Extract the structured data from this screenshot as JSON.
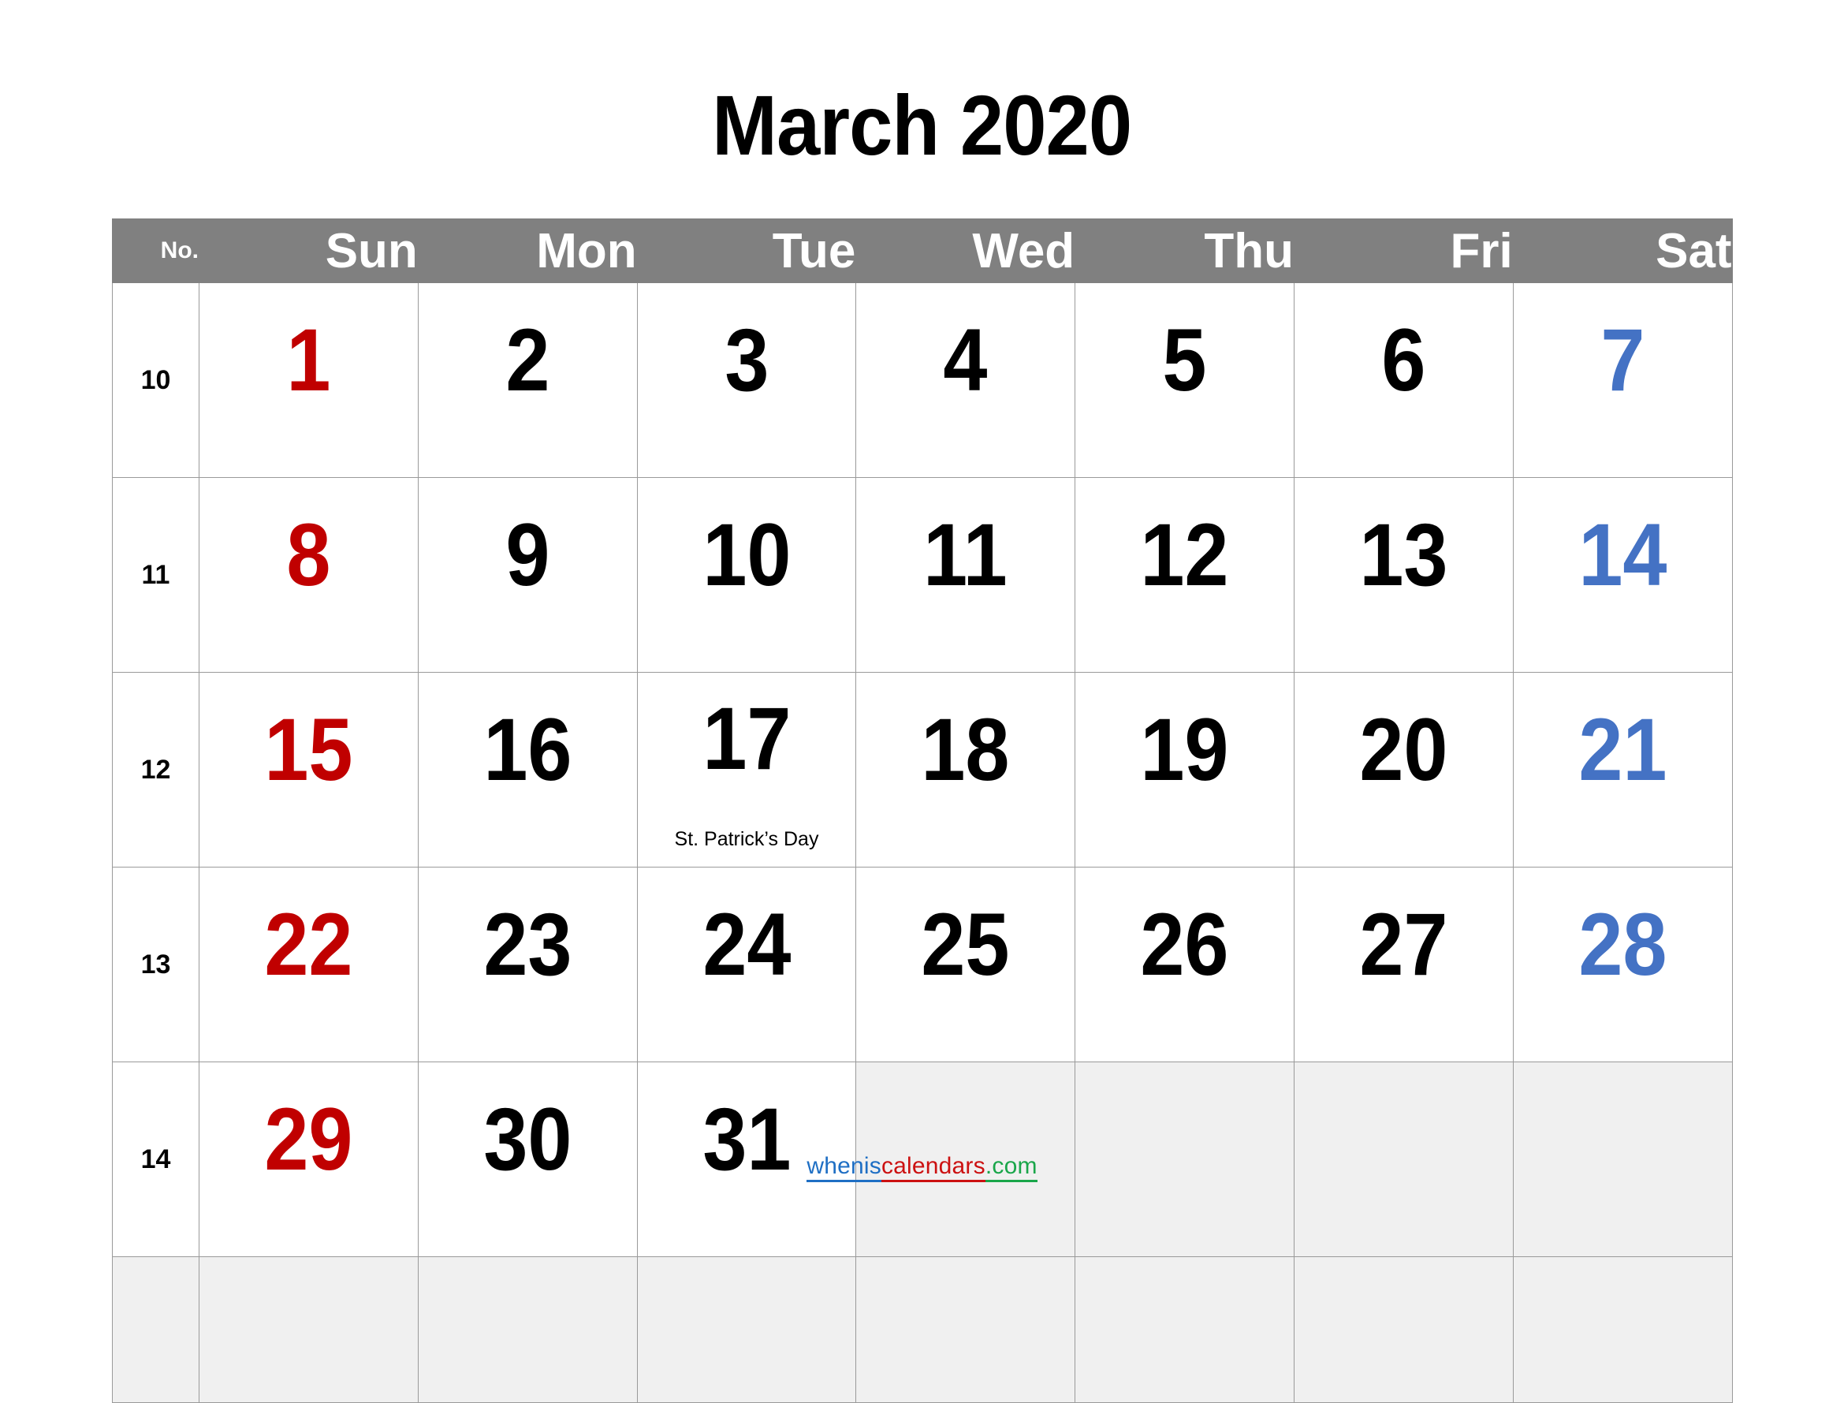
{
  "title": "March 2020",
  "header": {
    "week_number_label": "No.",
    "weekdays": [
      "Sun",
      "Mon",
      "Tue",
      "Wed",
      "Thu",
      "Fri",
      "Sat"
    ]
  },
  "colors": {
    "header_background": "#808080",
    "header_text": "#ffffff",
    "sunday": "#c00000",
    "saturday": "#4472c4",
    "weekday": "#000000",
    "empty_cell": "#f0f0f0",
    "grid_line": "#9a9a9a",
    "brand_blue": "#1f6fc4",
    "brand_red": "#cc1111",
    "brand_green": "#1aa64a"
  },
  "weeks": [
    {
      "week_number": "10",
      "days": [
        {
          "date": "1",
          "kind": "sun",
          "note": ""
        },
        {
          "date": "2",
          "kind": "weekday",
          "note": ""
        },
        {
          "date": "3",
          "kind": "weekday",
          "note": ""
        },
        {
          "date": "4",
          "kind": "weekday",
          "note": ""
        },
        {
          "date": "5",
          "kind": "weekday",
          "note": ""
        },
        {
          "date": "6",
          "kind": "weekday",
          "note": ""
        },
        {
          "date": "7",
          "kind": "sat",
          "note": ""
        }
      ]
    },
    {
      "week_number": "11",
      "days": [
        {
          "date": "8",
          "kind": "sun",
          "note": ""
        },
        {
          "date": "9",
          "kind": "weekday",
          "note": ""
        },
        {
          "date": "10",
          "kind": "weekday",
          "note": ""
        },
        {
          "date": "11",
          "kind": "weekday",
          "note": ""
        },
        {
          "date": "12",
          "kind": "weekday",
          "note": ""
        },
        {
          "date": "13",
          "kind": "weekday",
          "note": ""
        },
        {
          "date": "14",
          "kind": "sat",
          "note": ""
        }
      ]
    },
    {
      "week_number": "12",
      "days": [
        {
          "date": "15",
          "kind": "sun",
          "note": ""
        },
        {
          "date": "16",
          "kind": "weekday",
          "note": ""
        },
        {
          "date": "17",
          "kind": "weekday",
          "note": "St. Patrick’s Day"
        },
        {
          "date": "18",
          "kind": "weekday",
          "note": ""
        },
        {
          "date": "19",
          "kind": "weekday",
          "note": ""
        },
        {
          "date": "20",
          "kind": "weekday",
          "note": ""
        },
        {
          "date": "21",
          "kind": "sat",
          "note": ""
        }
      ]
    },
    {
      "week_number": "13",
      "days": [
        {
          "date": "22",
          "kind": "sun",
          "note": ""
        },
        {
          "date": "23",
          "kind": "weekday",
          "note": ""
        },
        {
          "date": "24",
          "kind": "weekday",
          "note": ""
        },
        {
          "date": "25",
          "kind": "weekday",
          "note": ""
        },
        {
          "date": "26",
          "kind": "weekday",
          "note": ""
        },
        {
          "date": "27",
          "kind": "weekday",
          "note": ""
        },
        {
          "date": "28",
          "kind": "sat",
          "note": ""
        }
      ]
    },
    {
      "week_number": "14",
      "days": [
        {
          "date": "29",
          "kind": "sun",
          "note": ""
        },
        {
          "date": "30",
          "kind": "weekday",
          "note": ""
        },
        {
          "date": "31",
          "kind": "weekday",
          "note": ""
        },
        {
          "date": "",
          "kind": "empty",
          "note": ""
        },
        {
          "date": "",
          "kind": "empty",
          "note": ""
        },
        {
          "date": "",
          "kind": "empty",
          "note": ""
        },
        {
          "date": "",
          "kind": "empty",
          "note": ""
        }
      ]
    },
    {
      "week_number": "",
      "days": [
        {
          "date": "",
          "kind": "empty",
          "note": ""
        },
        {
          "date": "",
          "kind": "empty",
          "note": ""
        },
        {
          "date": "",
          "kind": "empty",
          "note": ""
        },
        {
          "date": "",
          "kind": "empty",
          "note": ""
        },
        {
          "date": "",
          "kind": "empty",
          "note": ""
        },
        {
          "date": "",
          "kind": "empty",
          "note": ""
        },
        {
          "date": "",
          "kind": "empty",
          "note": ""
        }
      ]
    }
  ],
  "footer": {
    "brand_part_1": "whenis",
    "brand_part_2": "calendars",
    "brand_part_3": ".com"
  }
}
